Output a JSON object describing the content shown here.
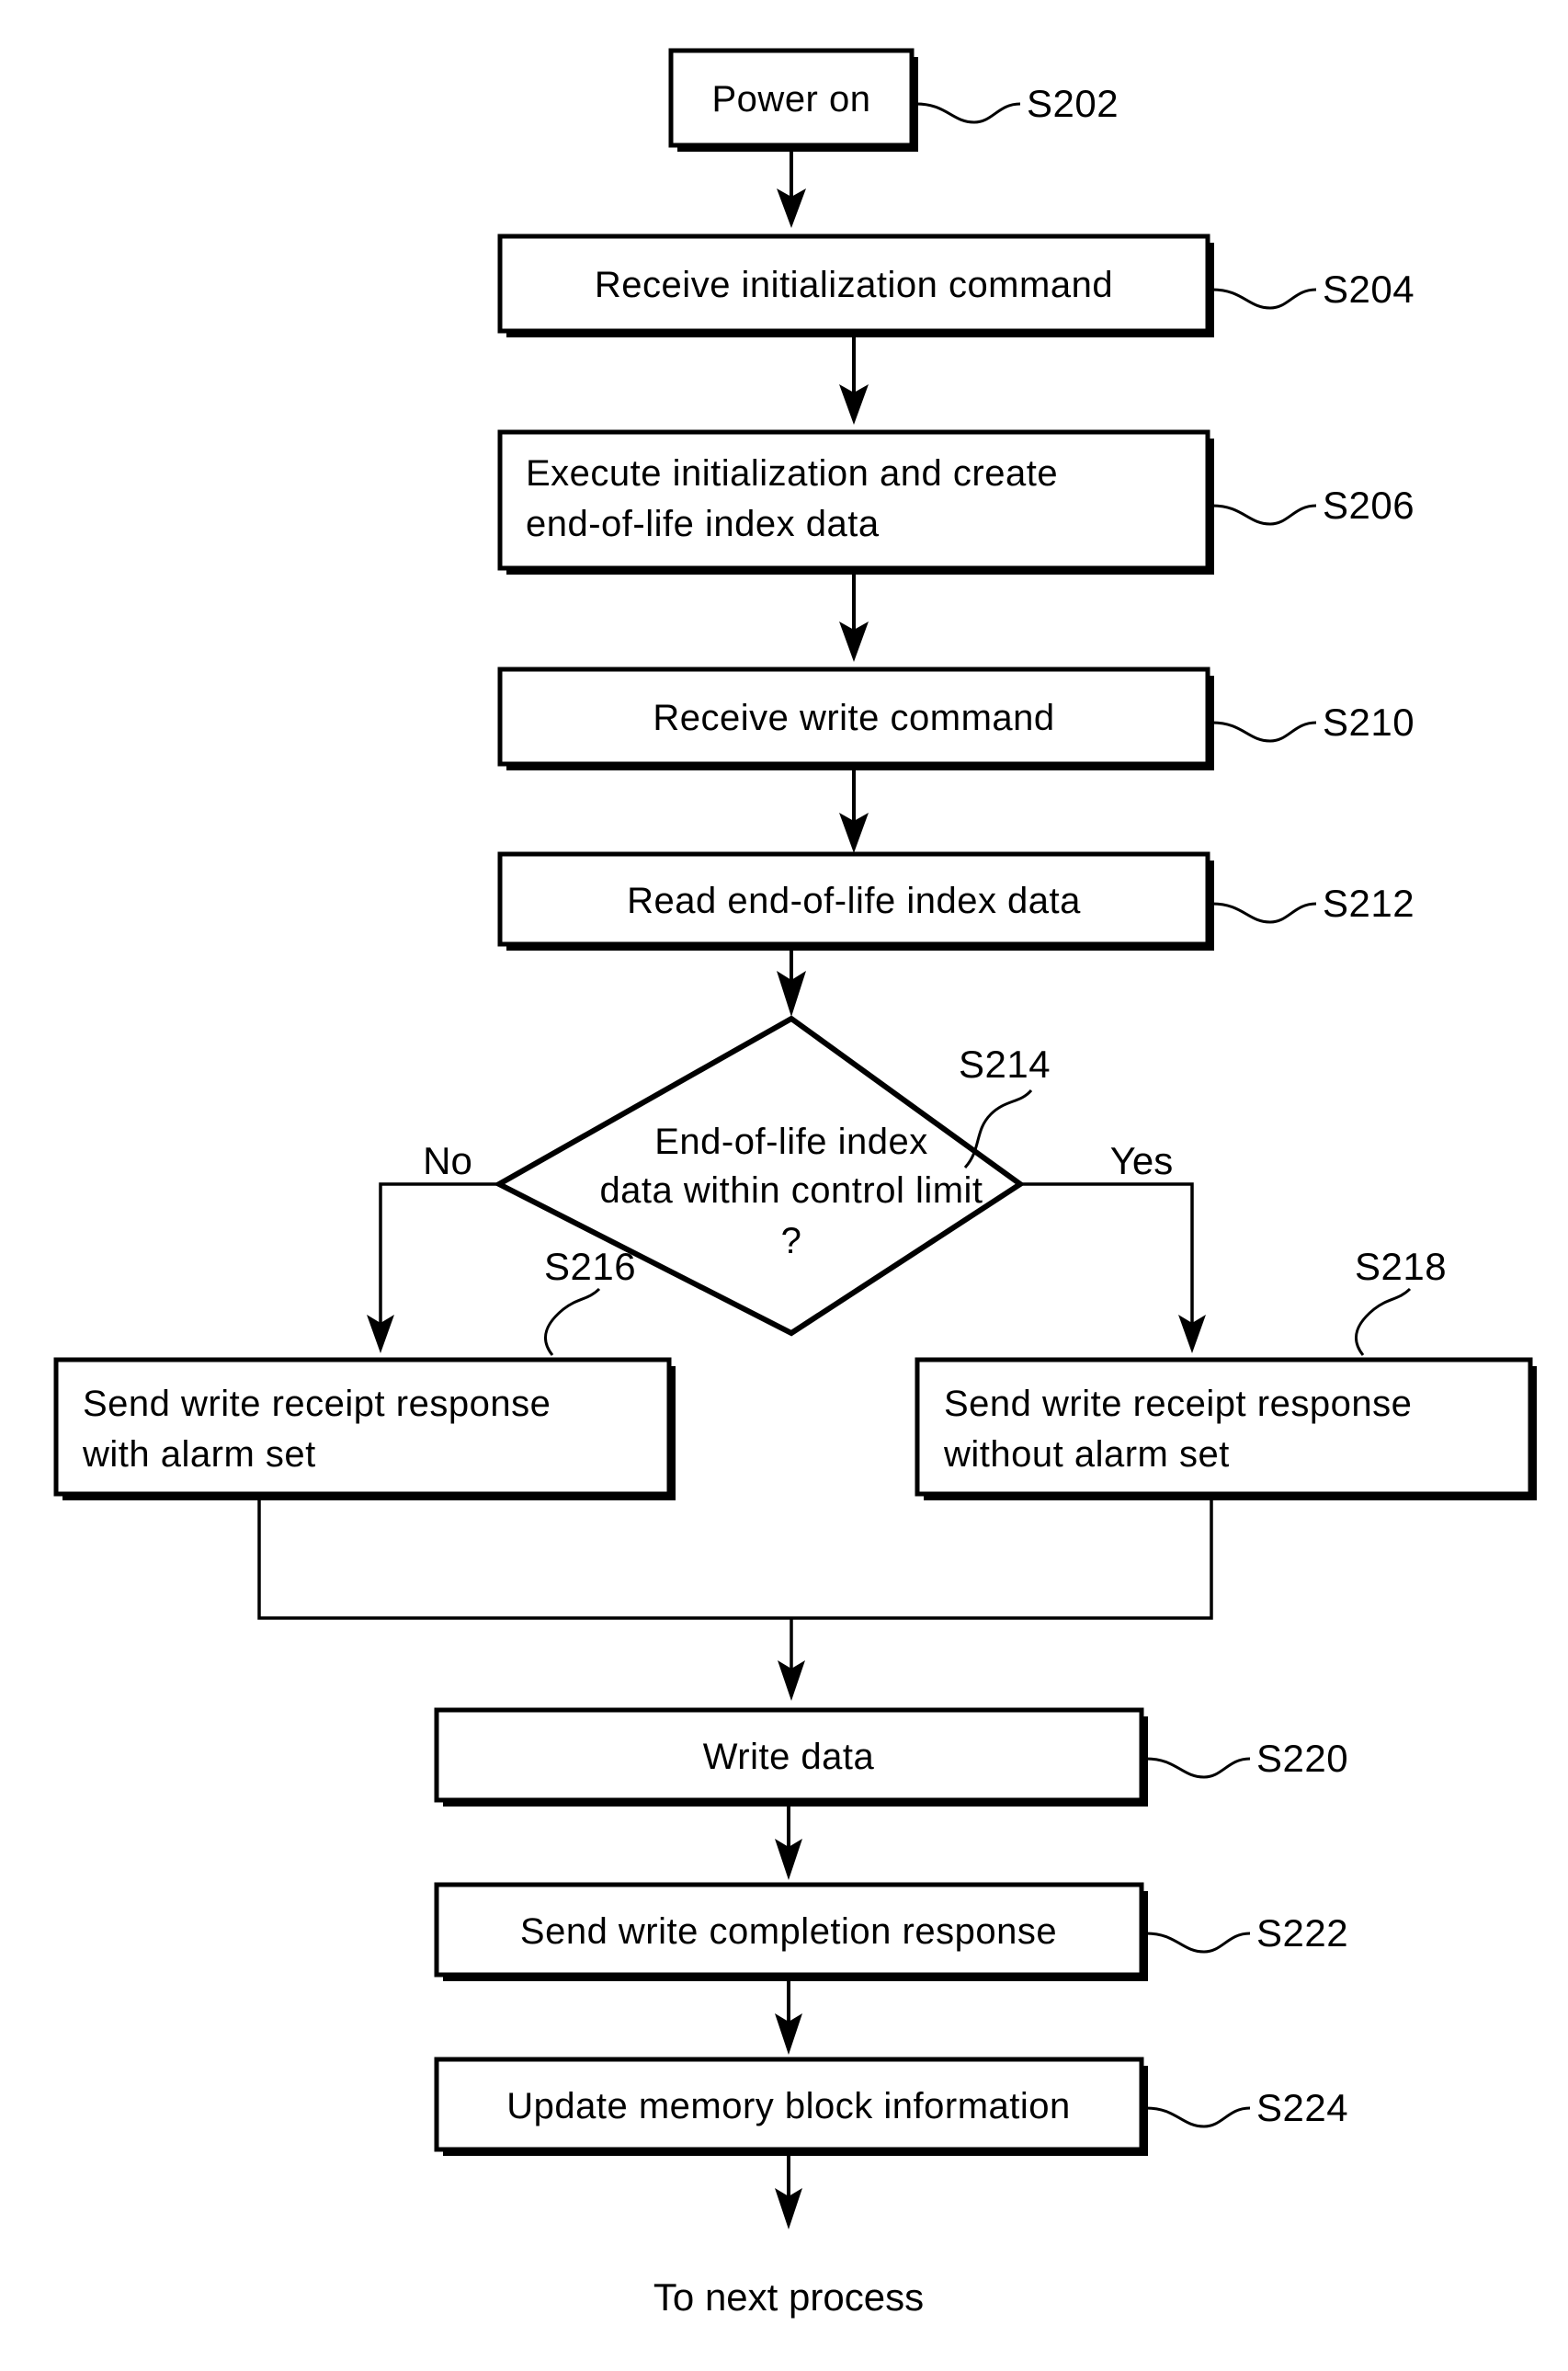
{
  "diagram": {
    "kind": "flowchart",
    "orientation": "top-to-bottom",
    "nodes": {
      "power_on": {
        "ref": "S202",
        "shape": "process",
        "lines": [
          "Power on"
        ]
      },
      "receive_init": {
        "ref": "S204",
        "shape": "process",
        "lines": [
          "Receive initialization command"
        ]
      },
      "execute_init": {
        "ref": "S206",
        "shape": "process",
        "lines": [
          "Execute initialization and create",
          "end-of-life index data"
        ]
      },
      "receive_write": {
        "ref": "S210",
        "shape": "process",
        "lines": [
          "Receive write command"
        ]
      },
      "read_index": {
        "ref": "S212",
        "shape": "process",
        "lines": [
          "Read end-of-life index data"
        ]
      },
      "decision": {
        "ref": "S214",
        "shape": "decision",
        "lines": [
          "End-of-life index",
          "data within control limit",
          "?"
        ],
        "branch_no": "No",
        "branch_yes": "Yes"
      },
      "send_with_alarm": {
        "ref": "S216",
        "shape": "process",
        "lines": [
          "Send write receipt response",
          "with alarm set"
        ]
      },
      "send_without_alarm": {
        "ref": "S218",
        "shape": "process",
        "lines": [
          "Send write receipt response",
          "without alarm set"
        ]
      },
      "write_data": {
        "ref": "S220",
        "shape": "process",
        "lines": [
          "Write data"
        ]
      },
      "send_completion": {
        "ref": "S222",
        "shape": "process",
        "lines": [
          "Send write completion response"
        ]
      },
      "update_block": {
        "ref": "S224",
        "shape": "process",
        "lines": [
          "Update memory block information"
        ]
      },
      "terminal": {
        "shape": "text",
        "lines": [
          "To next process"
        ]
      }
    },
    "colors": {
      "stroke": "#000000",
      "fill": "#ffffff",
      "background": "#ffffff"
    }
  }
}
